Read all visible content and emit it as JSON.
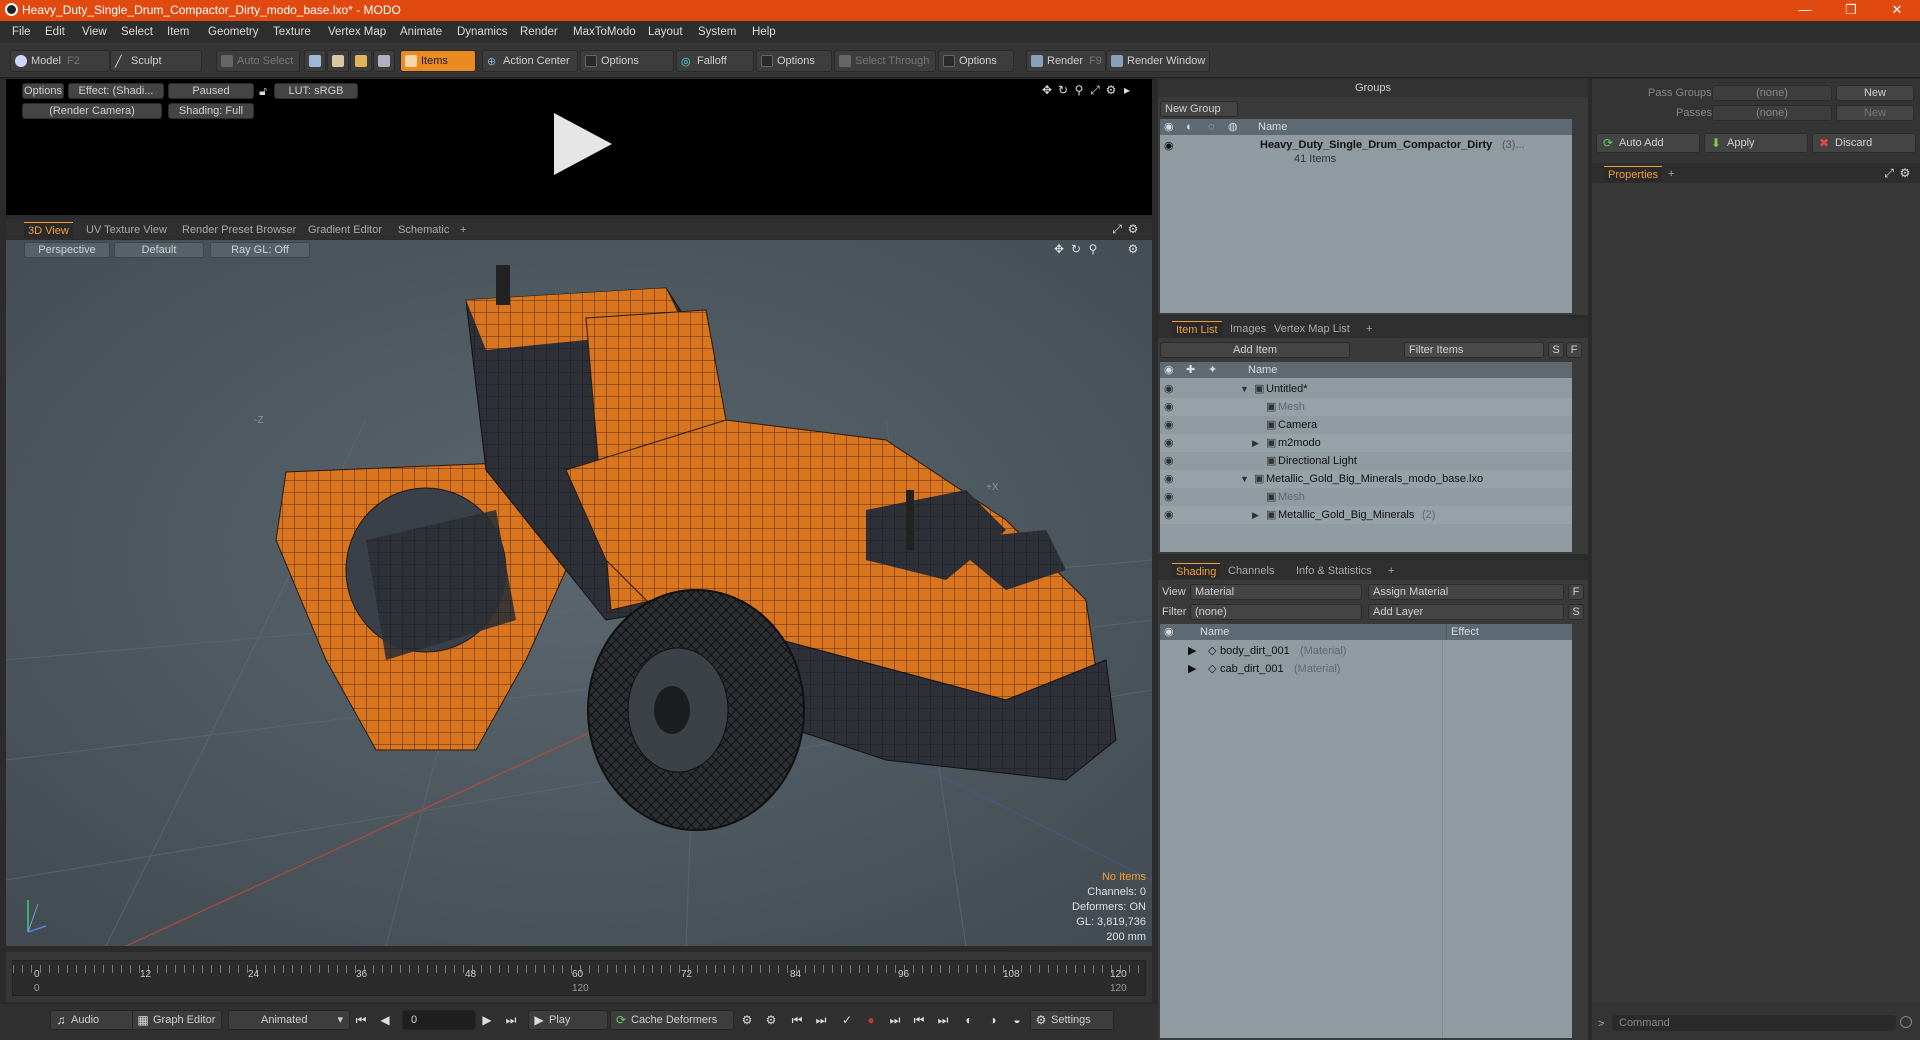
{
  "window": {
    "title": "Heavy_Duty_Single_Drum_Compactor_Dirty_modo_base.lxo* - MODO",
    "controls": [
      "—",
      "❐",
      "✕"
    ]
  },
  "menu": [
    "File",
    "Edit",
    "View",
    "Select",
    "Item",
    "Geometry",
    "Texture",
    "Vertex Map",
    "Animate",
    "Dynamics",
    "Render",
    "MaxToModo",
    "Layout",
    "System",
    "Help"
  ],
  "toolbar": {
    "model": "Model",
    "model_key": "F2",
    "sculpt": "Sculpt",
    "auto_select": "Auto Select",
    "items": "Items",
    "action_center": "Action Center",
    "options1": "Options",
    "falloff": "Falloff",
    "options2": "Options",
    "select_through": "Select Through",
    "options3": "Options",
    "render": "Render",
    "render_key": "F9",
    "render_window": "Render Window"
  },
  "preview": {
    "options": "Options",
    "effect": "Effect: (Shadi...",
    "paused": "Paused",
    "lut": "LUT: sRGB",
    "camera": "(Render Camera)",
    "shading": "Shading: Full"
  },
  "viewport_tabs": [
    "3D View",
    "UV Texture View",
    "Render Preset Browser",
    "Gradient Editor",
    "Schematic",
    "+"
  ],
  "viewport": {
    "perspective": "Perspective",
    "default": "Default",
    "raygl": "Ray GL: Off",
    "axis_z": "-Z",
    "axis_x": "+X",
    "status": {
      "no_items": "No Items",
      "channels": "Channels: 0",
      "deformers": "Deformers: ON",
      "gl": "GL: 3,819,736",
      "scale": "200 mm"
    }
  },
  "timeline": {
    "ticks": [
      "0",
      "12",
      "24",
      "36",
      "48",
      "60",
      "72",
      "84",
      "96",
      "108",
      "120"
    ],
    "start2": "0",
    "mid2": "120",
    "end2": "120"
  },
  "bottombar": {
    "audio": "Audio",
    "graph_editor": "Graph Editor",
    "animated": "Animated",
    "frame": "0",
    "play": "Play",
    "cache_deformers": "Cache Deformers",
    "settings": "Settings"
  },
  "groups": {
    "title": "Groups",
    "new_group": "New Group",
    "name_col": "Name",
    "item_name": "Heavy_Duty_Single_Drum_Compactor_Dirty",
    "item_count": "(3)...",
    "item_sub": "41 Items"
  },
  "itemlist": {
    "tabs": [
      "Item List",
      "Images",
      "Vertex Map List",
      "+"
    ],
    "add_item": "Add Item",
    "filter_items": "Filter Items",
    "s": "S",
    "f": "F",
    "name_col": "Name",
    "rows": [
      {
        "label": "Untitled*",
        "indent": 0,
        "dim": false,
        "arrow": "▼"
      },
      {
        "label": "Mesh",
        "indent": 2,
        "dim": true,
        "arrow": ""
      },
      {
        "label": "Camera",
        "indent": 2,
        "dim": false,
        "arrow": ""
      },
      {
        "label": "m2modo",
        "indent": 2,
        "dim": false,
        "arrow": "▶"
      },
      {
        "label": "Directional Light",
        "indent": 2,
        "dim": false,
        "arrow": ""
      },
      {
        "label": "Metallic_Gold_Big_Minerals_modo_base.lxo",
        "indent": 0,
        "dim": false,
        "arrow": "▼"
      },
      {
        "label": "Mesh",
        "indent": 2,
        "dim": true,
        "arrow": ""
      },
      {
        "label": "Metallic_Gold_Big_Minerals",
        "indent": 2,
        "dim": false,
        "arrow": "▶",
        "suffix": "(2)"
      }
    ]
  },
  "shading": {
    "tabs": [
      "Shading",
      "Channels",
      "Info & Statistics",
      "+"
    ],
    "view_label": "View",
    "view_value": "Material",
    "assign_material": "Assign Material",
    "filter_label": "Filter",
    "filter_value": "(none)",
    "add_layer": "Add Layer",
    "f": "F",
    "s": "S",
    "name_col": "Name",
    "effect_col": "Effect",
    "rows": [
      {
        "label": "body_dirt_001",
        "type": "(Material)"
      },
      {
        "label": "cab_dirt_001",
        "type": "(Material)"
      }
    ]
  },
  "right": {
    "pass_groups": "Pass Groups",
    "passes": "Passes",
    "none1": "(none)",
    "none2": "(none)",
    "new1": "New",
    "new2": "New",
    "auto_add": "Auto Add",
    "apply": "Apply",
    "discard": "Discard",
    "properties": "Properties",
    "plus": "+",
    "command": "Command"
  }
}
